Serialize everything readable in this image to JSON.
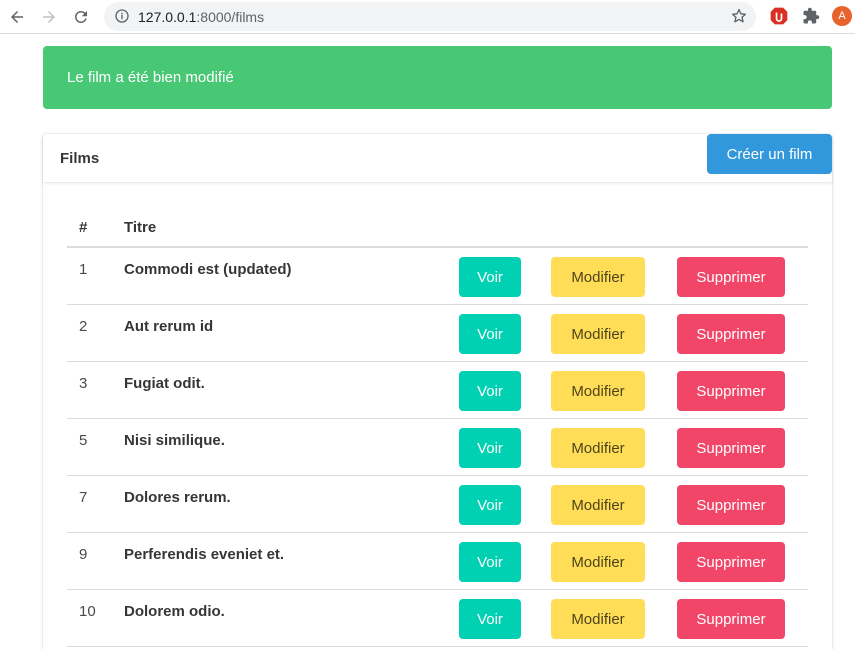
{
  "browser": {
    "url_host": "127.0.0.1",
    "url_rest": ":8000/films"
  },
  "profile": {
    "initial": "A"
  },
  "notification": {
    "message": "Le film a été bien modifié"
  },
  "card": {
    "title": "Films",
    "create_label": "Créer un film"
  },
  "table": {
    "headers": {
      "id": "#",
      "title": "Titre"
    },
    "rows": [
      {
        "id": "1",
        "title": "Commodi est (updated)"
      },
      {
        "id": "2",
        "title": "Aut rerum id"
      },
      {
        "id": "3",
        "title": "Fugiat odit."
      },
      {
        "id": "5",
        "title": "Nisi similique."
      },
      {
        "id": "7",
        "title": "Dolores rerum."
      },
      {
        "id": "9",
        "title": "Perferendis eveniet et."
      },
      {
        "id": "10",
        "title": "Dolorem odio."
      }
    ],
    "actions": {
      "view": "Voir",
      "edit": "Modifier",
      "delete": "Supprimer"
    }
  },
  "colors": {
    "success": "#48c774",
    "info": "#3298dc",
    "primary": "#00d1b2",
    "warning": "#ffdd57",
    "danger": "#f14668"
  }
}
